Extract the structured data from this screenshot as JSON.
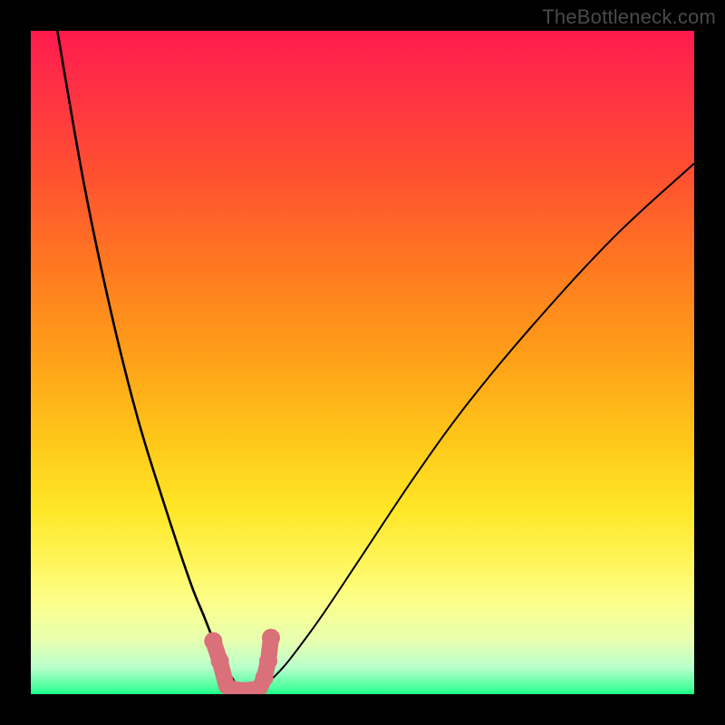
{
  "watermark": "TheBottleneck.com",
  "chart_data": {
    "type": "line",
    "title": "",
    "xlabel": "",
    "ylabel": "",
    "xlim": [
      0,
      100
    ],
    "ylim": [
      0,
      100
    ],
    "grid": false,
    "series": [
      {
        "name": "left-curve",
        "x": [
          4,
          8,
          12,
          16,
          20,
          24,
          26,
          28,
          29,
          30,
          31,
          32,
          33
        ],
        "y": [
          100,
          77,
          58,
          42,
          29,
          17,
          12,
          7,
          5,
          3,
          1.5,
          0.8,
          0.3
        ]
      },
      {
        "name": "right-curve",
        "x": [
          33,
          34,
          36,
          38,
          40,
          44,
          50,
          58,
          66,
          76,
          88,
          100
        ],
        "y": [
          0.3,
          0.6,
          2,
          4,
          6.5,
          12,
          21,
          33,
          44,
          56,
          69,
          80
        ]
      },
      {
        "name": "valley-marker",
        "x": [
          27.5,
          28.5,
          29.5,
          30.5,
          31.5,
          32.5,
          33.5,
          34.5,
          35.2,
          35.8,
          36.2
        ],
        "y": [
          8,
          5,
          1.2,
          0.8,
          0.6,
          0.6,
          0.7,
          0.9,
          2.5,
          5,
          8.5
        ]
      }
    ],
    "colors": {
      "curve": "#000000",
      "marker": "#d9707a",
      "gradient_top": "#ff1a4d",
      "gradient_bottom": "#19ff85"
    }
  }
}
